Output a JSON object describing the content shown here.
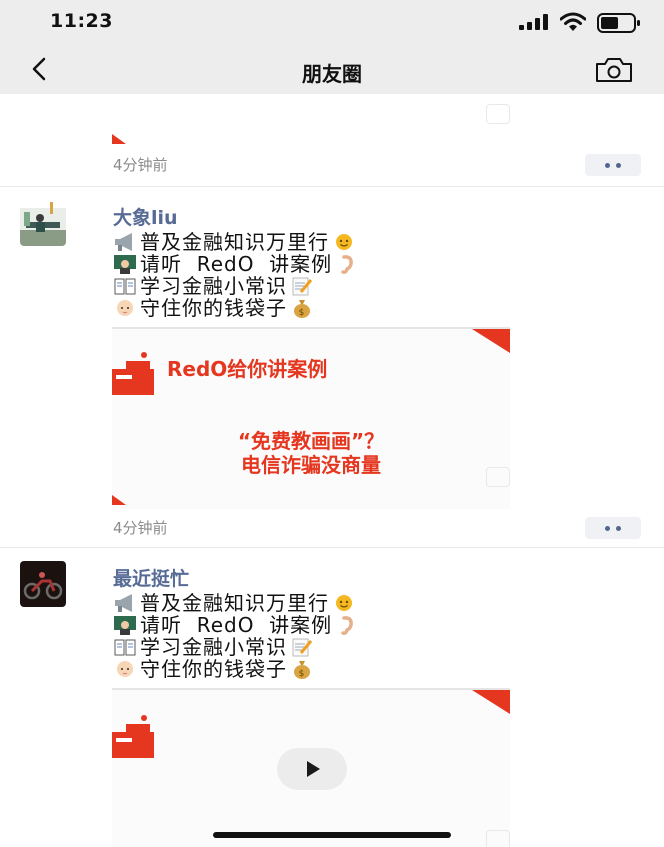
{
  "status_bar": {
    "time": "11:23"
  },
  "nav": {
    "title": "朋友圈"
  },
  "feed": {
    "partial_post": {
      "time_ago": "4分钟前"
    },
    "posts": [
      {
        "author": "大象liu",
        "lines": [
          {
            "emoji_icon": "megaphone-icon",
            "text": "普及金融知识万里行",
            "trail_icon": "sun-icon"
          },
          {
            "emoji_icon": "teacher-icon",
            "text": "请听  RedO  讲案例",
            "trail_icon": "ear-icon"
          },
          {
            "emoji_icon": "book-icon",
            "text": "学习金融小常识",
            "trail_icon": "memo-icon"
          },
          {
            "emoji_icon": "baby-icon",
            "text": "守住你的钱袋子",
            "trail_icon": "money-bag-icon"
          }
        ],
        "image": {
          "headline": "RedO给你讲案例",
          "line1": "“免费教画画”？",
          "line2": "电信诈骗没商量"
        },
        "time_ago": "4分钟前"
      },
      {
        "author": "最近挺忙",
        "lines": [
          {
            "emoji_icon": "megaphone-icon",
            "text": "普及金融知识万里行",
            "trail_icon": "sun-icon"
          },
          {
            "emoji_icon": "teacher-icon",
            "text": "请听  RedO  讲案例",
            "trail_icon": "ear-icon"
          },
          {
            "emoji_icon": "book-icon",
            "text": "学习金融小常识",
            "trail_icon": "memo-icon"
          },
          {
            "emoji_icon": "baby-icon",
            "text": "守住你的钱袋子",
            "trail_icon": "money-bag-icon"
          }
        ],
        "video": {
          "play_icon": "play-icon"
        }
      }
    ]
  },
  "colors": {
    "accent_name": "#576b95",
    "promo_red": "#e5361f",
    "bar_bg": "#ededed"
  }
}
